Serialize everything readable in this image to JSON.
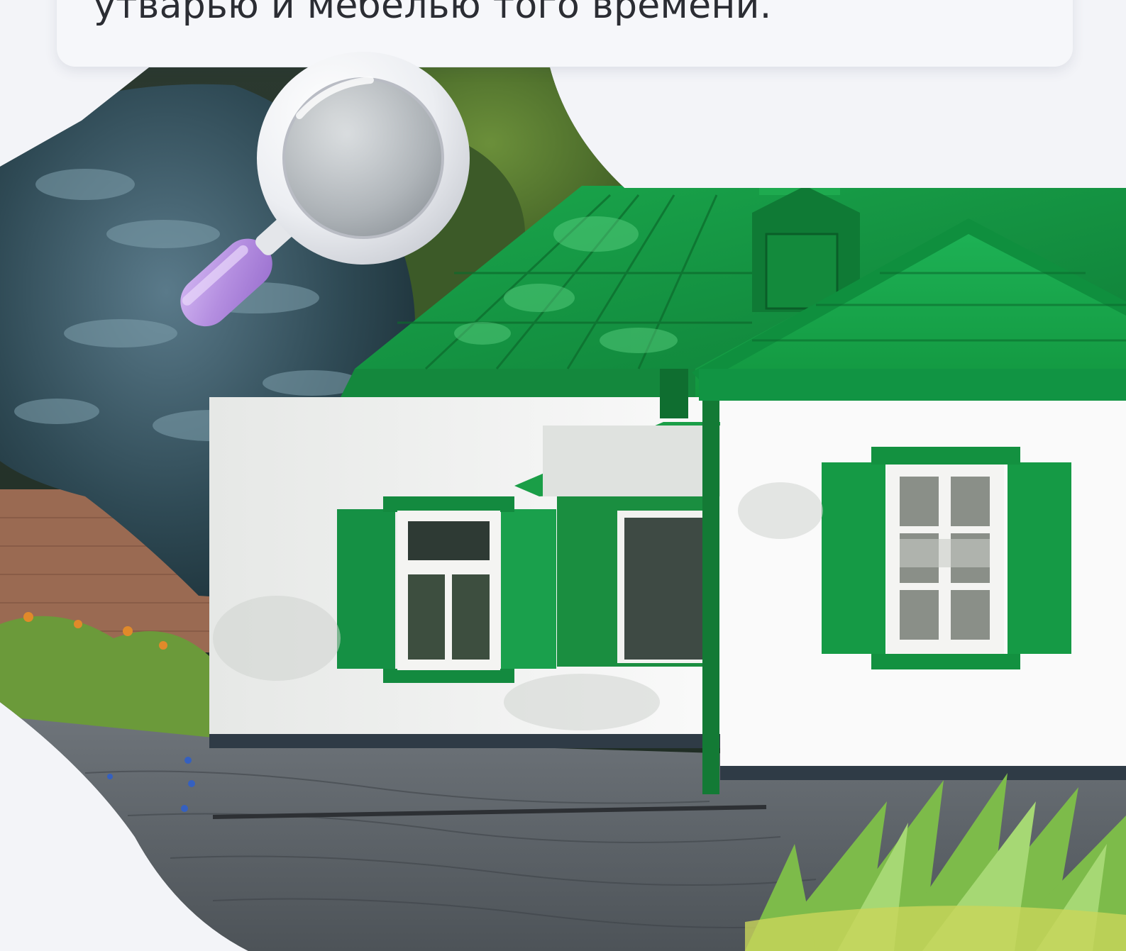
{
  "card": {
    "text": "утварью и мебелью того времени."
  },
  "icons": {
    "magnifier": "magnifier-icon"
  },
  "colors": {
    "background": "#f3f4f8",
    "card": "#f6f7fa",
    "text": "#2b2d33",
    "roof_green": "#1e9a48",
    "shutter_green": "#17923f",
    "wall_white": "#f7f7f4",
    "magnifier_handle": "#b48ee0"
  }
}
